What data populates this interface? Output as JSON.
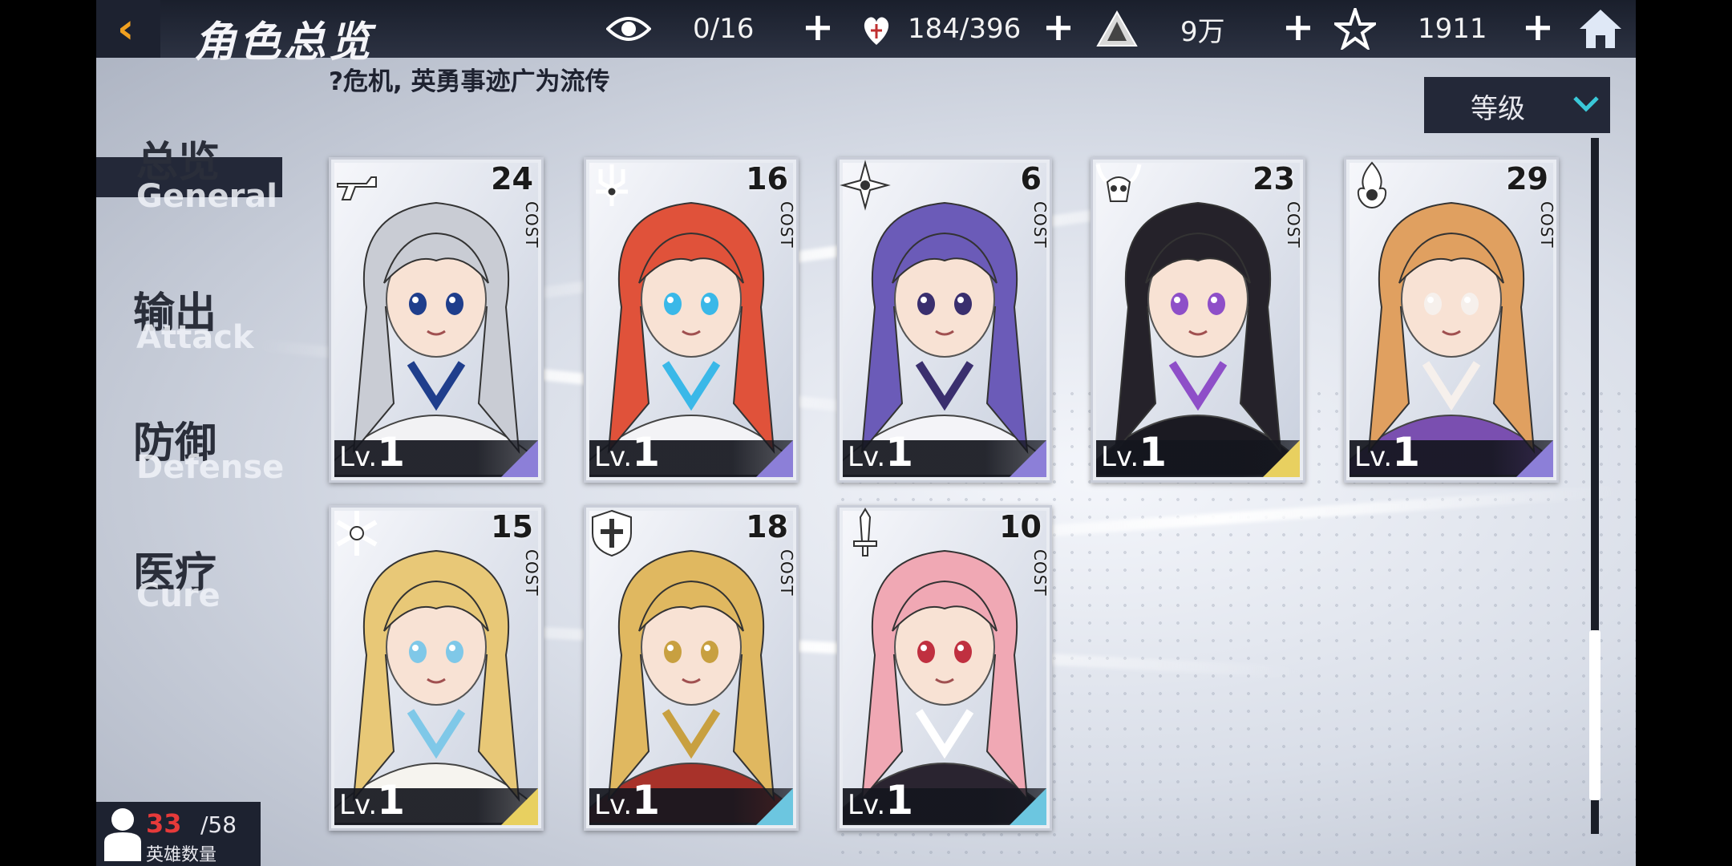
{
  "header": {
    "title": "角色总览",
    "resources": [
      {
        "name": "visibility",
        "icon": "eye-icon",
        "value": "0/16"
      },
      {
        "name": "stamina",
        "icon": "heart-icon",
        "value": "184/396"
      },
      {
        "name": "gold",
        "icon": "pyramid-icon",
        "value": "9万"
      },
      {
        "name": "crystal",
        "icon": "star-icon",
        "value": "1911"
      }
    ]
  },
  "ticker": "?危机, 英勇事迹广为流传",
  "sort": {
    "label": "等级"
  },
  "nav": [
    {
      "zh": "总览",
      "en": "General",
      "active": true
    },
    {
      "zh": "输出",
      "en": "Attack",
      "active": false
    },
    {
      "zh": "防御",
      "en": "Defense",
      "active": false
    },
    {
      "zh": "医疗",
      "en": "Cure",
      "active": false
    }
  ],
  "cost_label": "COST",
  "level_prefix": "Lv.",
  "cards": [
    {
      "cost": "24",
      "level": "1",
      "class_icon": "gun-icon",
      "rarity_color": "#8c7fd8",
      "hair": "#c9ccd4",
      "outfit": "#f2f2f4",
      "accent": "#1f3e8c"
    },
    {
      "cost": "16",
      "level": "1",
      "class_icon": "trident-icon",
      "rarity_color": "#8c7fd8",
      "hair": "#e0523a",
      "outfit": "#f3f3f6",
      "accent": "#3ab8e8"
    },
    {
      "cost": "6",
      "level": "1",
      "class_icon": "shuriken-icon",
      "rarity_color": "#8c7fd8",
      "hair": "#6b5bb8",
      "outfit": "#f4f4f8",
      "accent": "#3a2f6e"
    },
    {
      "cost": "23",
      "level": "1",
      "class_icon": "horned-skull-icon",
      "rarity_color": "#e8d060",
      "hair": "#25222a",
      "outfit": "#1b1a22",
      "accent": "#8e4fc8"
    },
    {
      "cost": "29",
      "level": "1",
      "class_icon": "flame-icon",
      "rarity_color": "#8c7fd8",
      "hair": "#e0a060",
      "outfit": "#7a4fb0",
      "accent": "#f6f0ec"
    },
    {
      "cost": "15",
      "level": "1",
      "class_icon": "snowflake-icon",
      "rarity_color": "#e8d060",
      "hair": "#e8c877",
      "outfit": "#f6f4ef",
      "accent": "#7fc8e8"
    },
    {
      "cost": "18",
      "level": "1",
      "class_icon": "shield-icon",
      "rarity_color": "#6cc6e0",
      "hair": "#e0b860",
      "outfit": "#a8322a",
      "accent": "#c8a040"
    },
    {
      "cost": "10",
      "level": "1",
      "class_icon": "sword-icon",
      "rarity_color": "#6cc6e0",
      "hair": "#f0a8b4",
      "outfit": "#2a2430",
      "accent": "#ffffff"
    }
  ],
  "hero_count": {
    "current": "33",
    "max": "/58",
    "label": "英雄数量"
  }
}
